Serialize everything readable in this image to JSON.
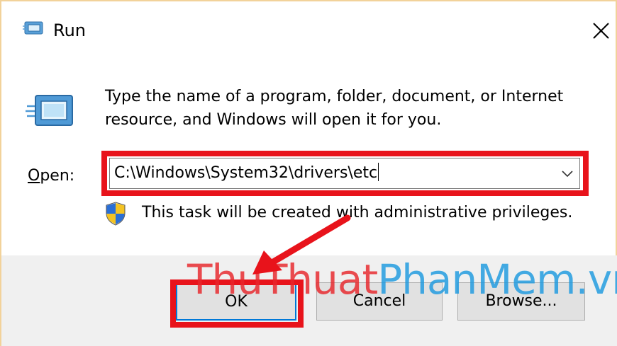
{
  "window": {
    "title": "Run",
    "close_icon": "close-icon",
    "app_icon": "run-app-icon"
  },
  "dialog": {
    "description": "Type the name of a program, folder, document, or Internet resource, and Windows will open it for you.",
    "open_label_accel": "O",
    "open_label_rest": "pen:",
    "open_value": "C:\\Windows\\System32\\drivers\\etc",
    "admin_notice": "This task will be created with administrative privileges."
  },
  "buttons": {
    "ok": "OK",
    "cancel": "Cancel",
    "browse": "Browse..."
  },
  "watermark": {
    "part1": "ThuThuat",
    "part2": "PhanMem.vn"
  },
  "colors": {
    "highlight": "#e8131b",
    "watermark_red": "#e8262b",
    "watermark_blue": "#1d9ae0",
    "footer_bg": "#f0f0f0",
    "ok_border": "#0078d7"
  }
}
